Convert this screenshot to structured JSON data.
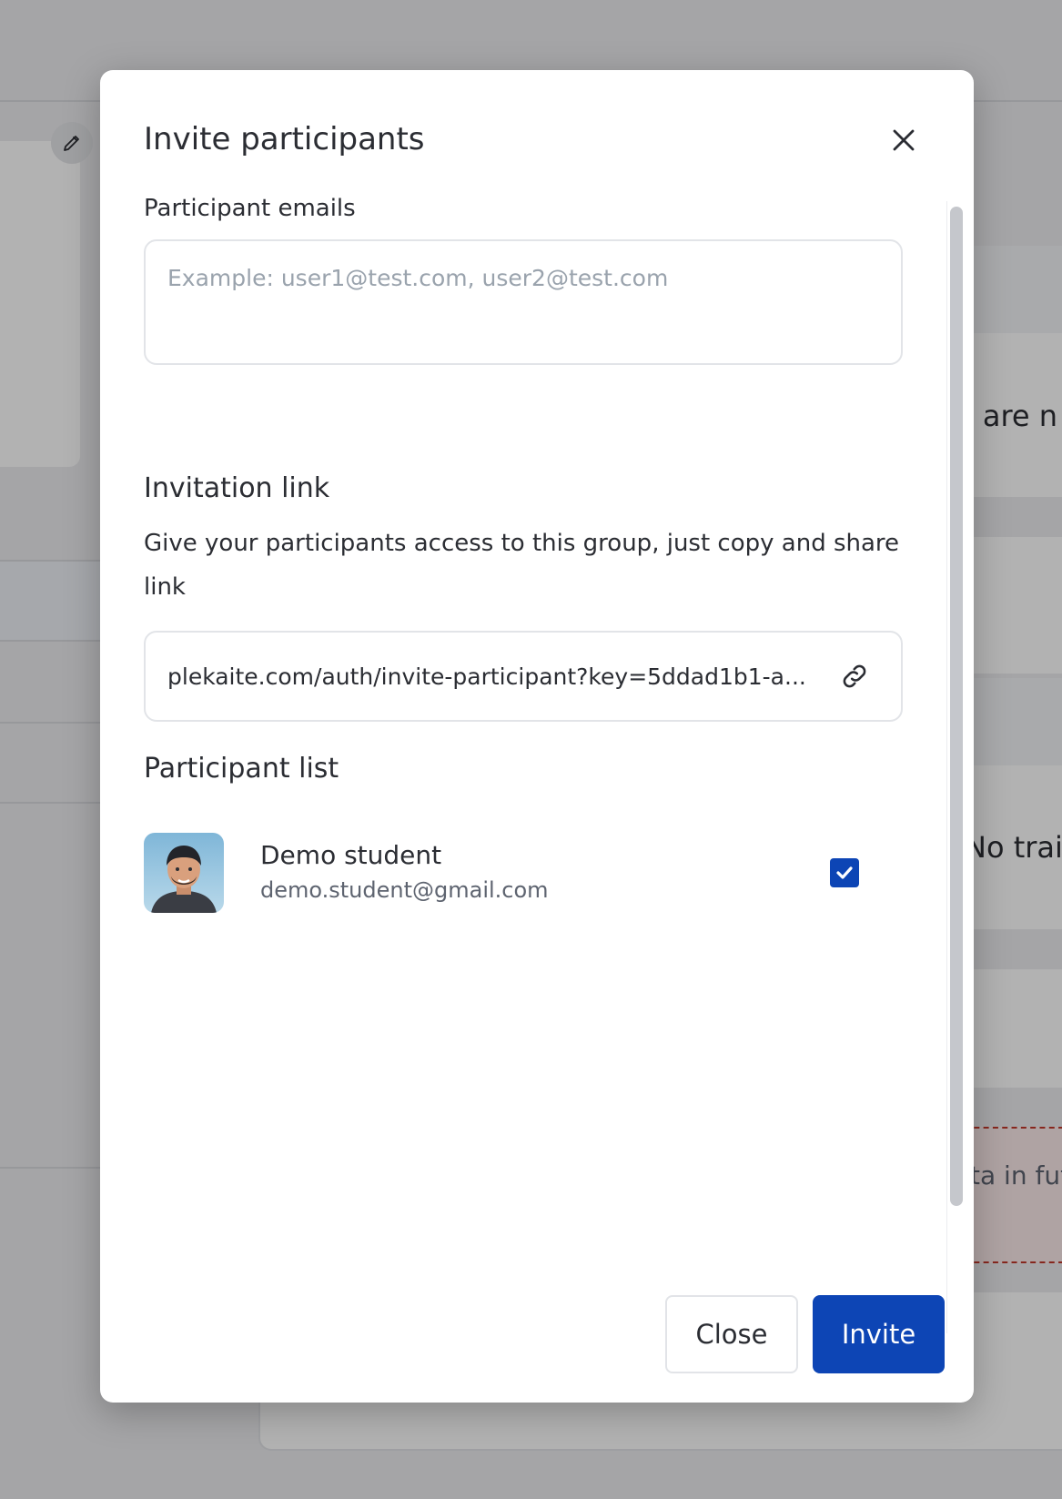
{
  "background": {
    "fragment_1": "e are n",
    "fragment_2": "No train",
    "fragment_3": "ta in fut"
  },
  "modal": {
    "title": "Invite participants",
    "close_icon": "close-icon",
    "emails": {
      "label": "Participant emails",
      "placeholder": "Example: user1@test.com, user2@test.com",
      "value": ""
    },
    "invitation": {
      "title": "Invitation link",
      "description": "Give your participants access to this group, just copy and share link",
      "link": "plekaite.com/auth/invite-participant?key=5ddad1b1-a...",
      "copy_icon": "link-icon"
    },
    "participants": {
      "title": "Participant list",
      "items": [
        {
          "name": "Demo student",
          "email": "demo.student@gmail.com",
          "checked": true
        }
      ]
    },
    "buttons": {
      "close": "Close",
      "invite": "Invite"
    },
    "colors": {
      "primary": "#0d45b5",
      "border": "#e2e4e8",
      "text": "#2b2d33",
      "muted": "#5e6470",
      "placeholder": "#9aa3ad"
    }
  }
}
